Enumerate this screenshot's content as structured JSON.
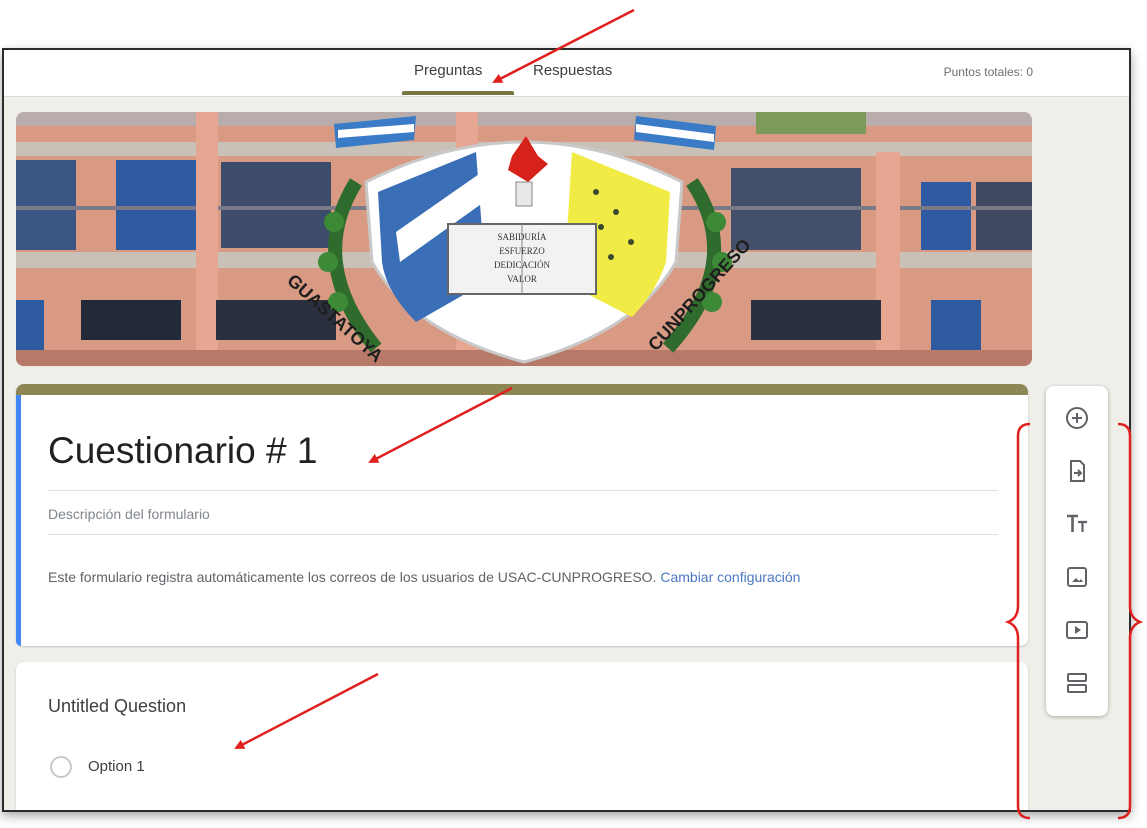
{
  "tabs": {
    "questions": "Preguntas",
    "responses": "Respuestas"
  },
  "points_label": "Puntos totales: 0",
  "form": {
    "title": "Cuestionario # 1",
    "description_placeholder": "Descripción del formulario",
    "notice_text": "Este formulario registra automáticamente los correos de los usuarios de USAC-CUNPROGRESO.",
    "notice_link": "Cambiar configuración"
  },
  "question": {
    "title": "Untitled Question",
    "options": [
      "Option 1"
    ]
  },
  "banner": {
    "crest_lines": [
      "SABIDURÍA",
      "ESFUERZO",
      "DEDICACIÓN",
      "VALOR"
    ],
    "arc_left": "GUASTATOYA",
    "arc_right": "CUNPROGRESO"
  },
  "toolbar": {
    "items": [
      {
        "icon": "add-question-icon"
      },
      {
        "icon": "import-questions-icon"
      },
      {
        "icon": "title-text-icon"
      },
      {
        "icon": "image-icon"
      },
      {
        "icon": "video-icon"
      },
      {
        "icon": "section-icon"
      }
    ]
  },
  "colors": {
    "theme": "#8d8755",
    "accent": "#4285f4",
    "annotation": "#e0201e"
  }
}
